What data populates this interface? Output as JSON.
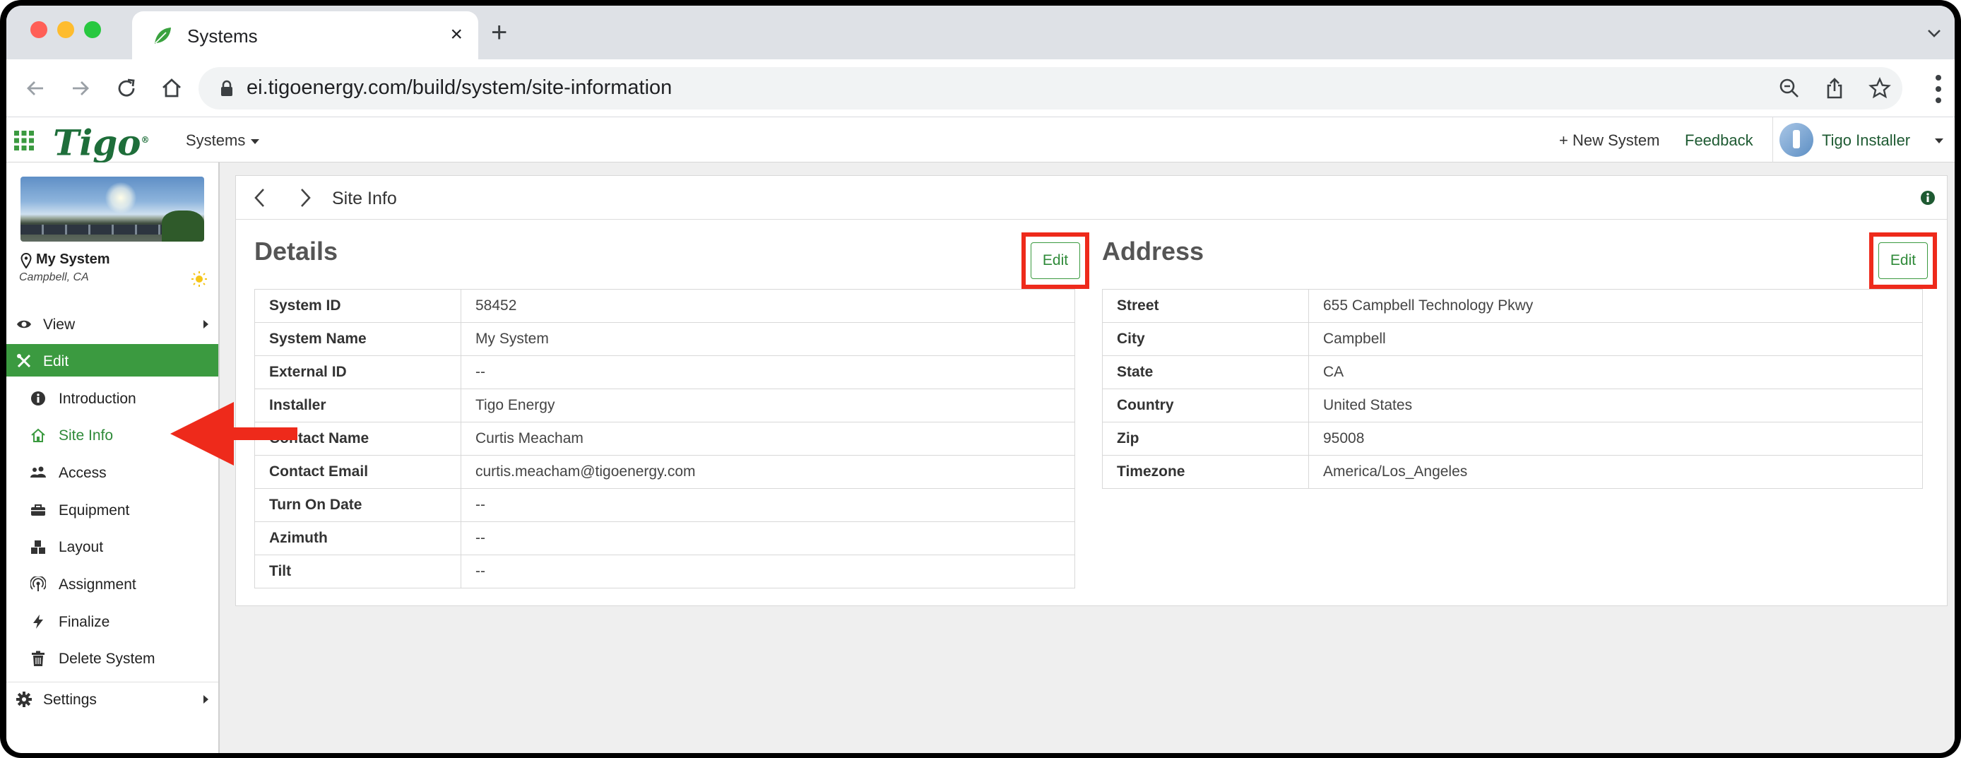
{
  "browser": {
    "tab_title": "Systems",
    "tab_close": "×",
    "new_tab": "+",
    "url": "ei.tigoenergy.com/build/system/site-information"
  },
  "header": {
    "logo": "Tigo",
    "logo_mark": "®",
    "systems_menu": "Systems",
    "new_system": "+ New System",
    "feedback": "Feedback",
    "user_name": "Tigo Installer"
  },
  "sidebar": {
    "site_name": "My System",
    "site_location": "Campbell, CA",
    "items": [
      {
        "label": "View",
        "icon": "eye-icon"
      },
      {
        "label": "Edit",
        "icon": "tools-icon"
      },
      {
        "label": "Introduction",
        "icon": "info-circle-icon"
      },
      {
        "label": "Site Info",
        "icon": "house-icon"
      },
      {
        "label": "Access",
        "icon": "users-icon"
      },
      {
        "label": "Equipment",
        "icon": "toolbox-icon"
      },
      {
        "label": "Layout",
        "icon": "blocks-icon"
      },
      {
        "label": "Assignment",
        "icon": "antenna-icon"
      },
      {
        "label": "Finalize",
        "icon": "bolt-icon"
      },
      {
        "label": "Delete System",
        "icon": "trash-icon"
      },
      {
        "label": "Settings",
        "icon": "gear-icon"
      }
    ]
  },
  "main": {
    "page_title": "Site Info",
    "details": {
      "title": "Details",
      "edit_label": "Edit",
      "rows": [
        {
          "key": "System ID",
          "value": "58452"
        },
        {
          "key": "System Name",
          "value": "My System"
        },
        {
          "key": "External ID",
          "value": "--"
        },
        {
          "key": "Installer",
          "value": "Tigo Energy"
        },
        {
          "key": "Contact Name",
          "value": "Curtis Meacham"
        },
        {
          "key": "Contact Email",
          "value": "curtis.meacham@tigoenergy.com"
        },
        {
          "key": "Turn On Date",
          "value": "--"
        },
        {
          "key": "Azimuth",
          "value": "--"
        },
        {
          "key": "Tilt",
          "value": "--"
        }
      ]
    },
    "address": {
      "title": "Address",
      "edit_label": "Edit",
      "rows": [
        {
          "key": "Street",
          "value": "655 Campbell Technology Pkwy"
        },
        {
          "key": "City",
          "value": "Campbell"
        },
        {
          "key": "State",
          "value": "CA"
        },
        {
          "key": "Country",
          "value": "United States"
        },
        {
          "key": "Zip",
          "value": "95008"
        },
        {
          "key": "Timezone",
          "value": "America/Los_Angeles"
        }
      ]
    }
  },
  "colors": {
    "brand_green": "#3b9a40",
    "logo_green": "#1e6e3a",
    "highlight_red": "#ee2a1b"
  }
}
